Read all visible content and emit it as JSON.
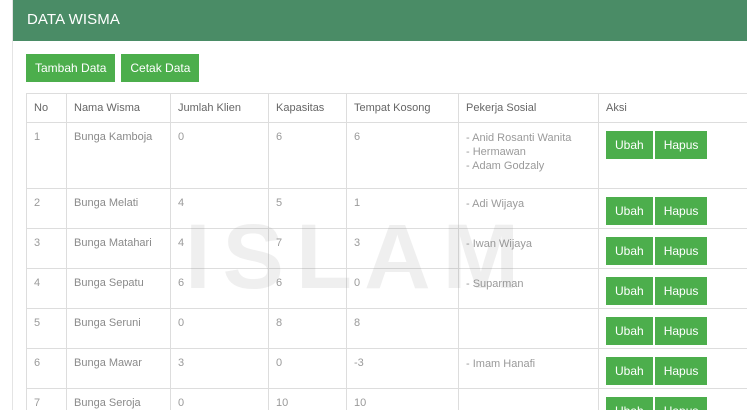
{
  "header": {
    "title": "DATA WISMA"
  },
  "toolbar": {
    "add_label": "Tambah Data",
    "print_label": "Cetak Data"
  },
  "table": {
    "columns": [
      "No",
      "Nama Wisma",
      "Jumlah Klien",
      "Kapasitas",
      "Tempat Kosong",
      "Pekerja Sosial",
      "Aksi"
    ],
    "rows": [
      {
        "no": "1",
        "name": "Bunga Kamboja",
        "clients": "0",
        "capacity": "6",
        "empty": "6",
        "workers": [
          "- Anid Rosanti Wanita",
          "- Hermawan",
          "- Adam Godzaly"
        ]
      },
      {
        "no": "2",
        "name": "Bunga Melati",
        "clients": "4",
        "capacity": "5",
        "empty": "1",
        "workers": [
          "- Adi Wijaya"
        ]
      },
      {
        "no": "3",
        "name": "Bunga Matahari",
        "clients": "4",
        "capacity": "7",
        "empty": "3",
        "workers": [
          "- Iwan Wijaya"
        ]
      },
      {
        "no": "4",
        "name": "Bunga Sepatu",
        "clients": "6",
        "capacity": "6",
        "empty": "0",
        "workers": [
          "- Suparman"
        ]
      },
      {
        "no": "5",
        "name": "Bunga Seruni",
        "clients": "0",
        "capacity": "8",
        "empty": "8",
        "workers": []
      },
      {
        "no": "6",
        "name": "Bunga Mawar",
        "clients": "3",
        "capacity": "0",
        "empty": "-3",
        "workers": [
          "- Imam Hanafi"
        ]
      },
      {
        "no": "7",
        "name": "Bunga Seroja",
        "clients": "0",
        "capacity": "10",
        "empty": "10",
        "workers": []
      }
    ],
    "edit_label": "Ubah",
    "delete_label": "Hapus"
  },
  "watermark": {
    "text": "ISLAM"
  },
  "colors": {
    "header": "#4a8c66",
    "button": "#4cae4c"
  }
}
